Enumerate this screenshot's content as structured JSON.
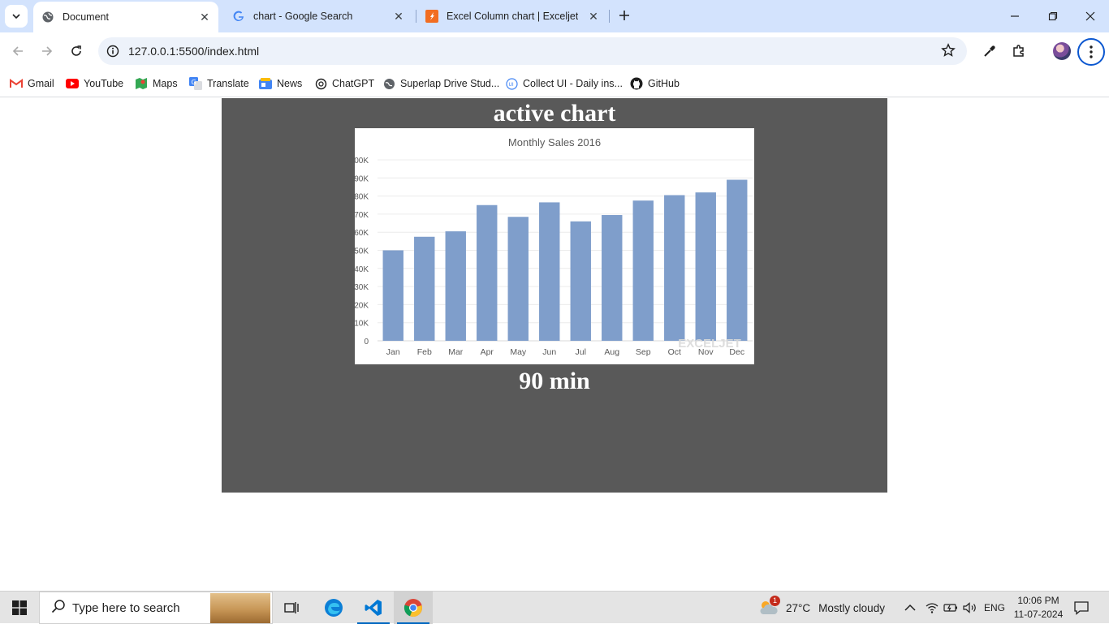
{
  "browser": {
    "tabs": [
      {
        "title": "Document",
        "active": true
      },
      {
        "title": "chart - Google Search",
        "active": false
      },
      {
        "title": "Excel Column chart | Exceljet",
        "active": false
      }
    ],
    "address": "127.0.0.1:5500/index.html",
    "bookmarks": [
      "Gmail",
      "YouTube",
      "Maps",
      "Translate",
      "News",
      "ChatGPT",
      "Superlap Drive Stud...",
      "Collect UI - Daily ins...",
      "GitHub"
    ]
  },
  "page": {
    "heading": "active chart",
    "subheading": "90 min"
  },
  "chart_data": {
    "type": "bar",
    "title": "Monthly Sales 2016",
    "categories": [
      "Jan",
      "Feb",
      "Mar",
      "Apr",
      "May",
      "Jun",
      "Jul",
      "Aug",
      "Sep",
      "Oct",
      "Nov",
      "Dec"
    ],
    "values": [
      50000,
      57500,
      60500,
      75000,
      68500,
      76500,
      66000,
      69500,
      77500,
      80500,
      82000,
      89000
    ],
    "ylim": [
      0,
      100000
    ],
    "yticks": [
      "0",
      "10K",
      "20K",
      "30K",
      "40K",
      "50K",
      "60K",
      "70K",
      "80K",
      "90K",
      "00K"
    ],
    "grid": true,
    "bar_color": "#7f9ecb",
    "watermark": "EXCELJET"
  },
  "taskbar": {
    "search_placeholder": "Type here to search",
    "weather_temp": "27°C",
    "weather_desc": "Mostly cloudy",
    "weather_badge": "1",
    "language": "ENG",
    "time": "10:06 PM",
    "date": "11-07-2024"
  }
}
